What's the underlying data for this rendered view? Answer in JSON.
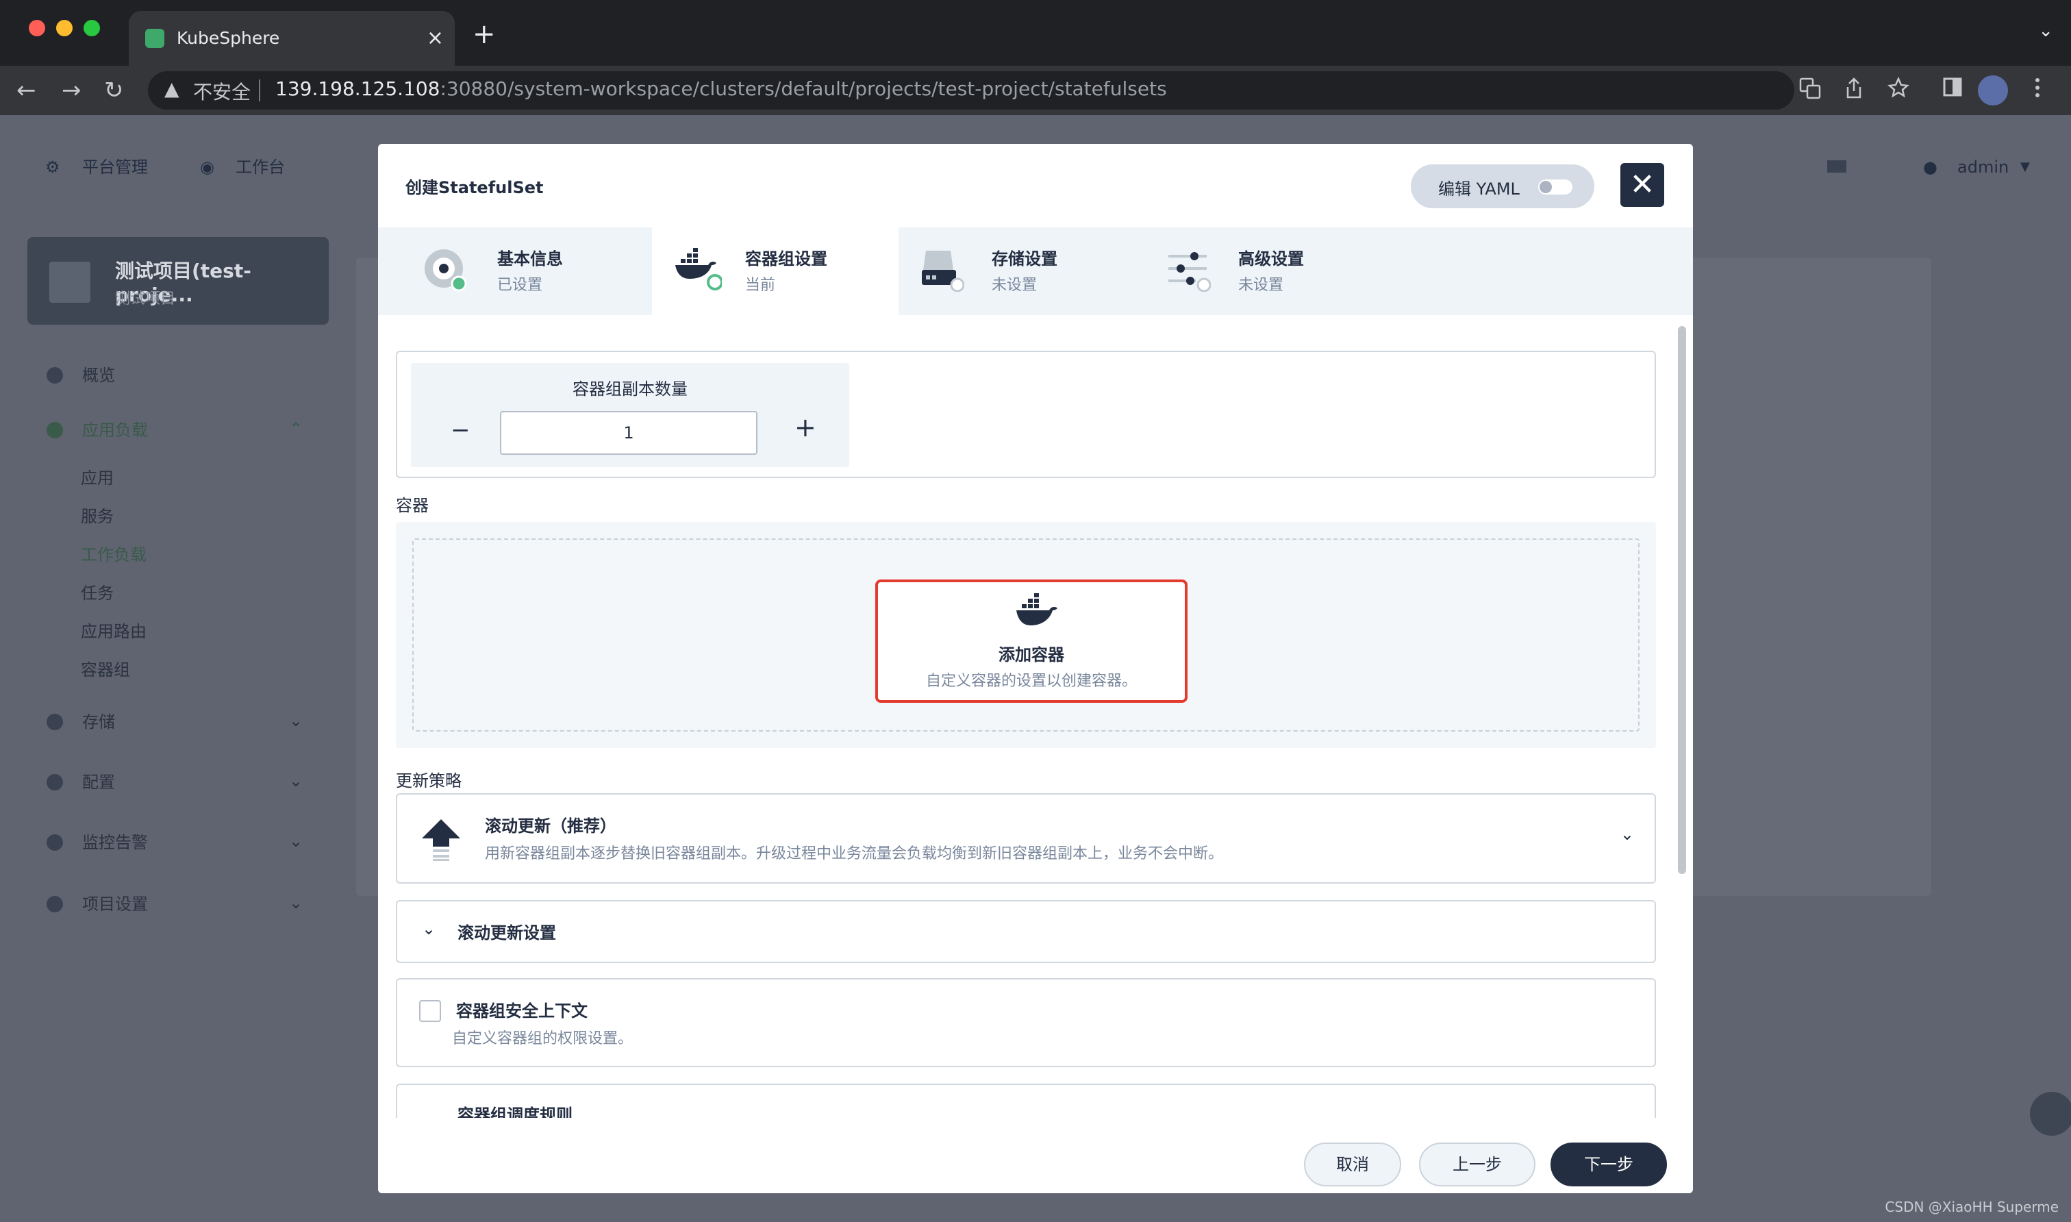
{
  "browser": {
    "tab_title": "KubeSphere",
    "tab_close": "×",
    "new_tab": "+",
    "tab_menu": "⌄",
    "nav_back": "←",
    "nav_forward": "→",
    "nav_reload": "↻",
    "security_warning": "▲",
    "security_text": "不安全",
    "url_host": "139.198.125.108",
    "url_rest": ":30880/system-workspace/clusters/default/projects/test-project/statefulsets"
  },
  "app": {
    "topnav": {
      "platform": "平台管理",
      "workbench": "工作台",
      "user": "admin"
    },
    "project": {
      "name": "测试项目(test-proje...",
      "subtitle": "测试项目"
    },
    "sidebar": {
      "overview": "概览",
      "workloads": "应用负载",
      "sub": [
        "应用",
        "服务",
        "工作负载",
        "任务",
        "应用路由",
        "容器组"
      ],
      "storage": "存储",
      "config": "配置",
      "monitoring": "监控告警",
      "settings": "项目设置"
    }
  },
  "modal": {
    "title": "创建StatefulSet",
    "yaml_label": "编辑 YAML",
    "close": "✕",
    "steps": [
      {
        "title": "基本信息",
        "status": "已设置"
      },
      {
        "title": "容器组设置",
        "status": "当前"
      },
      {
        "title": "存储设置",
        "status": "未设置"
      },
      {
        "title": "高级设置",
        "status": "未设置"
      }
    ],
    "replicas": {
      "label": "容器组副本数量",
      "value": "1",
      "minus": "−",
      "plus": "+"
    },
    "containers_label": "容器",
    "add_container": {
      "title": "添加容器",
      "desc": "自定义容器的设置以创建容器。"
    },
    "update_strategy_label": "更新策略",
    "strategy": {
      "title": "滚动更新（推荐）",
      "desc": "用新容器组副本逐步替换旧容器组副本。升级过程中业务流量会负载均衡到新旧容器组副本上，业务不会中断。"
    },
    "rolling_settings": "滚动更新设置",
    "security_context": {
      "title": "容器组安全上下文",
      "desc": "自定义容器组的权限设置。"
    },
    "scheduling": "容器组调度规则",
    "buttons": {
      "cancel": "取消",
      "prev": "上一步",
      "next": "下一步"
    }
  },
  "watermark": "CSDN @XiaoHH Superme",
  "colors": {
    "primary": "#242e42",
    "highlight": "#e33b2e",
    "success": "#55bc8a",
    "overlay": "#5f6470"
  }
}
